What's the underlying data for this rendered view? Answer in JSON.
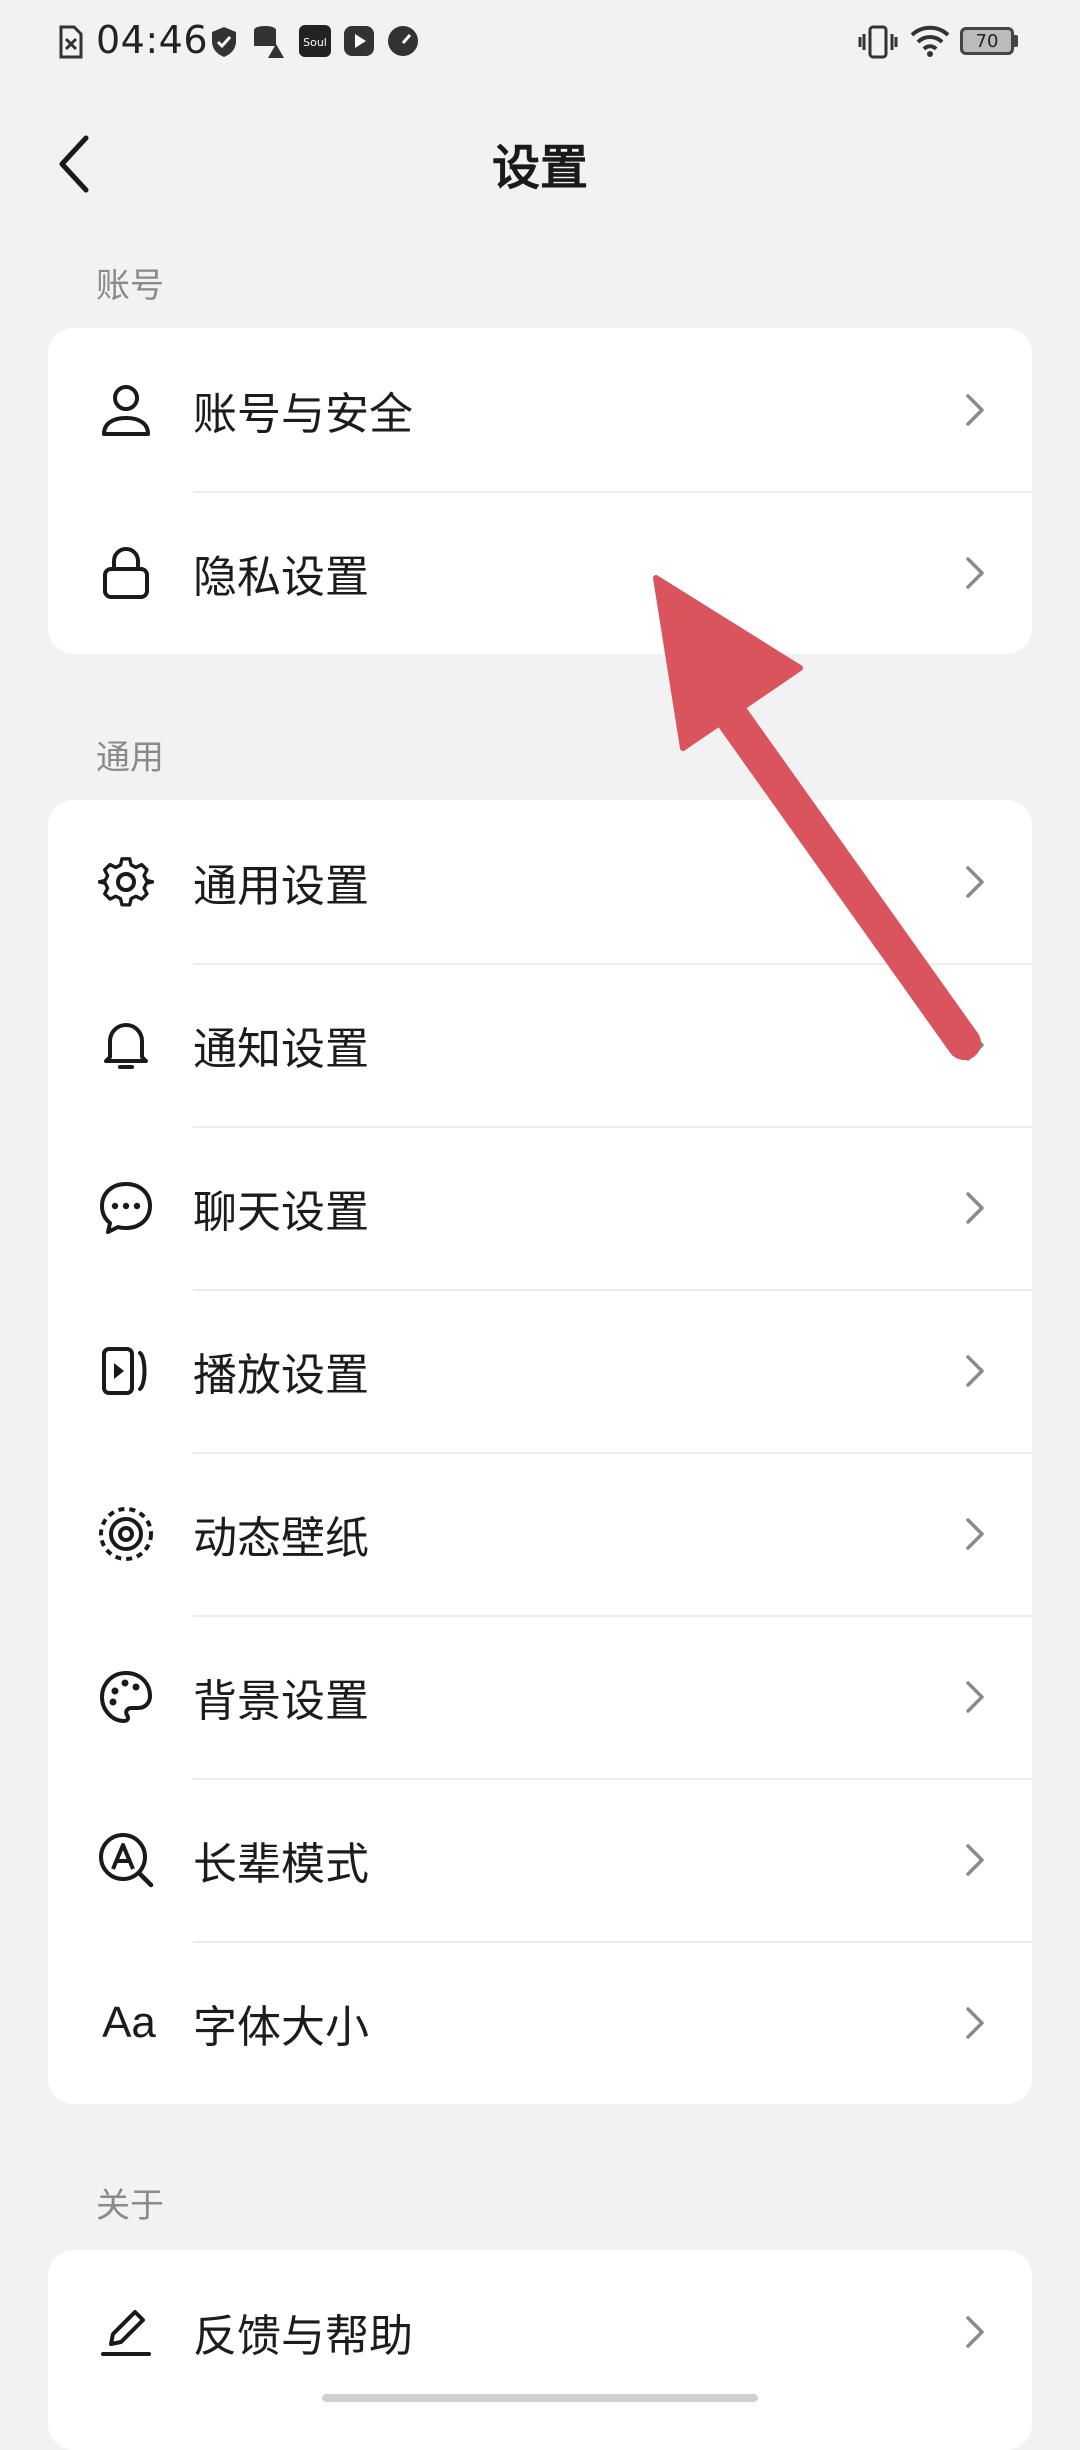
{
  "status_bar": {
    "time": "04:46",
    "battery": "70",
    "icons": [
      "sim-error-icon",
      "shield-icon",
      "data-warning-icon",
      "soul-app-icon",
      "video-play-icon",
      "speedometer-icon",
      "vibrate-icon",
      "wifi-icon",
      "battery-icon"
    ]
  },
  "header": {
    "title": "设置",
    "back_icon": "chevron-left-icon"
  },
  "sections": {
    "account": {
      "label": "账号",
      "items": [
        {
          "label": "账号与安全",
          "icon": "user-icon"
        },
        {
          "label": "隐私设置",
          "icon": "lock-icon"
        }
      ]
    },
    "general": {
      "label": "通用",
      "items": [
        {
          "label": "通用设置",
          "icon": "gear-icon"
        },
        {
          "label": "通知设置",
          "icon": "bell-icon"
        },
        {
          "label": "聊天设置",
          "icon": "chat-bubble-icon"
        },
        {
          "label": "播放设置",
          "icon": "play-screen-icon"
        },
        {
          "label": "动态壁纸",
          "icon": "wallpaper-icon"
        },
        {
          "label": "背景设置",
          "icon": "palette-icon"
        },
        {
          "label": "长辈模式",
          "icon": "elder-mode-icon"
        },
        {
          "label": "字体大小",
          "icon": "font-size-icon",
          "icon_text": "Aa"
        }
      ]
    },
    "about": {
      "label": "关于",
      "items": [
        {
          "label": "反馈与帮助",
          "icon": "edit-icon"
        }
      ]
    }
  },
  "colors": {
    "background": "#f2f2f2",
    "card": "#ffffff",
    "annotation_arrow": "#d9545c",
    "section_label": "#8a8a8a"
  }
}
